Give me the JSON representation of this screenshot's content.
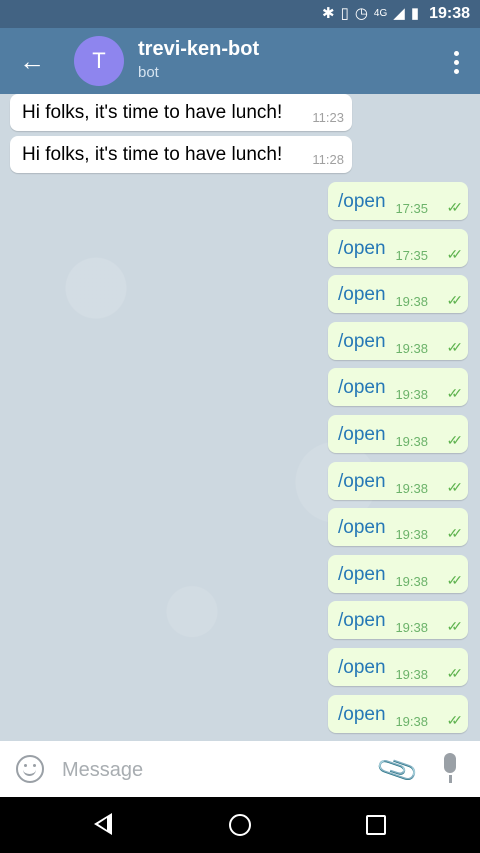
{
  "status_bar": {
    "bluetooth_icon": "bluetooth-icon",
    "vibrate_icon": "vibrate-icon",
    "alarm_icon": "alarm-icon",
    "network_label": "4G",
    "time": "19:38"
  },
  "header": {
    "avatar_letter": "T",
    "avatar_color": "#8e85ee",
    "title": "trevi-ken-bot",
    "subtitle": "bot"
  },
  "messages": [
    {
      "direction": "in",
      "text": "Hi folks, it's time to have lunch!",
      "time": "11:23"
    },
    {
      "direction": "in",
      "text": "Hi folks, it's time to have lunch!",
      "time": "11:28"
    },
    {
      "direction": "out",
      "text": "/open",
      "time": "17:35",
      "status": "read"
    },
    {
      "direction": "out",
      "text": "/open",
      "time": "17:35",
      "status": "read"
    },
    {
      "direction": "out",
      "text": "/open",
      "time": "19:38",
      "status": "read"
    },
    {
      "direction": "out",
      "text": "/open",
      "time": "19:38",
      "status": "read"
    },
    {
      "direction": "out",
      "text": "/open",
      "time": "19:38",
      "status": "read"
    },
    {
      "direction": "out",
      "text": "/open",
      "time": "19:38",
      "status": "read"
    },
    {
      "direction": "out",
      "text": "/open",
      "time": "19:38",
      "status": "read"
    },
    {
      "direction": "out",
      "text": "/open",
      "time": "19:38",
      "status": "read"
    },
    {
      "direction": "out",
      "text": "/open",
      "time": "19:38",
      "status": "read"
    },
    {
      "direction": "out",
      "text": "/open",
      "time": "19:38",
      "status": "read"
    },
    {
      "direction": "out",
      "text": "/open",
      "time": "19:38",
      "status": "read"
    },
    {
      "direction": "out",
      "text": "/open",
      "time": "19:38",
      "status": "read"
    }
  ],
  "input": {
    "placeholder": "Message",
    "value": ""
  },
  "colors": {
    "header": "#517da2",
    "outgoing_bubble": "#effdde",
    "outgoing_text": "#2678b6",
    "read_check": "#5fb34f"
  }
}
